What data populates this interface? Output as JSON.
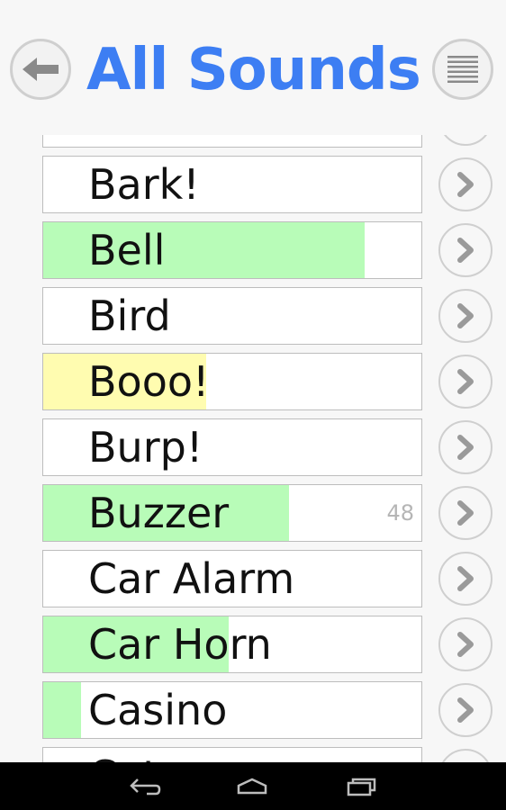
{
  "header": {
    "title": "All Sounds",
    "back_icon": "back-arrow-icon",
    "menu_icon": "menu-lines-icon"
  },
  "colors": {
    "title": "#3d7ef3",
    "green_fill": "#b8fcb8",
    "yellow_fill": "#fffcb0"
  },
  "sounds": [
    {
      "label": "",
      "fill": 0,
      "fill_color": "none",
      "count": ""
    },
    {
      "label": "Bark!",
      "fill": 0,
      "fill_color": "none",
      "count": ""
    },
    {
      "label": "Bell",
      "fill": 0.85,
      "fill_color": "green",
      "count": ""
    },
    {
      "label": "Bird",
      "fill": 0,
      "fill_color": "none",
      "count": ""
    },
    {
      "label": "Booo!",
      "fill": 0.43,
      "fill_color": "yellow",
      "count": ""
    },
    {
      "label": "Burp!",
      "fill": 0,
      "fill_color": "none",
      "count": ""
    },
    {
      "label": "Buzzer",
      "fill": 0.65,
      "fill_color": "green",
      "count": "48"
    },
    {
      "label": "Car Alarm",
      "fill": 0,
      "fill_color": "none",
      "count": ""
    },
    {
      "label": "Car Horn",
      "fill": 0.49,
      "fill_color": "green",
      "count": ""
    },
    {
      "label": "Casino",
      "fill": 0.1,
      "fill_color": "green",
      "count": ""
    },
    {
      "label": "Cat",
      "fill": 0,
      "fill_color": "none",
      "count": ""
    }
  ],
  "navbar": {
    "back_icon": "nav-back-icon",
    "home_icon": "nav-home-icon",
    "recents_icon": "nav-recents-icon"
  }
}
